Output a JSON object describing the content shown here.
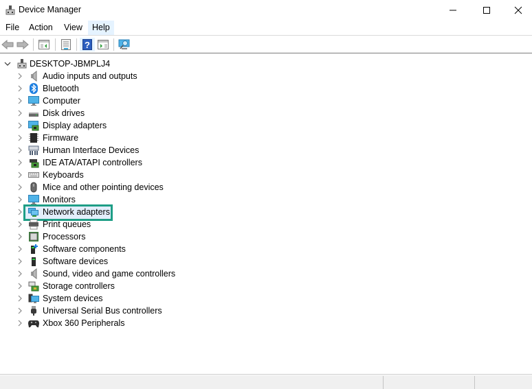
{
  "window": {
    "title": "Device Manager",
    "controls": [
      "minimize",
      "maximize",
      "close"
    ]
  },
  "menubar": {
    "items": [
      {
        "label": "File"
      },
      {
        "label": "Action"
      },
      {
        "label": "View"
      },
      {
        "label": "Help",
        "hovered": true
      }
    ]
  },
  "toolbar": {
    "buttons": [
      {
        "name": "back",
        "icon": "back-arrow-icon",
        "enabled": false
      },
      {
        "name": "forward",
        "icon": "forward-arrow-icon",
        "enabled": false
      },
      {
        "name": "show-hide-console-tree",
        "icon": "console-tree-icon"
      },
      {
        "name": "properties",
        "icon": "properties-icon"
      },
      {
        "name": "help",
        "icon": "help-icon",
        "hovered": true
      },
      {
        "name": "show-hide-action-pane",
        "icon": "action-pane-icon"
      },
      {
        "name": "scan-hardware",
        "icon": "monitor-scan-icon"
      }
    ]
  },
  "tree": {
    "root": {
      "label": "DESKTOP-JBMPLJ4",
      "expanded": true,
      "icon": "computer-tower-icon"
    },
    "children": [
      {
        "label": "Audio inputs and outputs",
        "icon": "speaker-icon"
      },
      {
        "label": "Bluetooth",
        "icon": "bluetooth-icon"
      },
      {
        "label": "Computer",
        "icon": "monitor-icon"
      },
      {
        "label": "Disk drives",
        "icon": "disk-drive-icon"
      },
      {
        "label": "Display adapters",
        "icon": "display-adapter-icon"
      },
      {
        "label": "Firmware",
        "icon": "chip-icon"
      },
      {
        "label": "Human Interface Devices",
        "icon": "hid-icon"
      },
      {
        "label": "IDE ATA/ATAPI controllers",
        "icon": "ide-controller-icon"
      },
      {
        "label": "Keyboards",
        "icon": "keyboard-icon"
      },
      {
        "label": "Mice and other pointing devices",
        "icon": "mouse-icon"
      },
      {
        "label": "Monitors",
        "icon": "monitor-icon"
      },
      {
        "label": "Network adapters",
        "icon": "network-adapter-icon",
        "selected": true
      },
      {
        "label": "Print queues",
        "icon": "printer-icon"
      },
      {
        "label": "Processors",
        "icon": "processor-icon"
      },
      {
        "label": "Software components",
        "icon": "software-component-icon"
      },
      {
        "label": "Software devices",
        "icon": "software-device-icon"
      },
      {
        "label": "Sound, video and game controllers",
        "icon": "speaker-icon"
      },
      {
        "label": "Storage controllers",
        "icon": "storage-controller-icon"
      },
      {
        "label": "System devices",
        "icon": "system-devices-icon"
      },
      {
        "label": "Universal Serial Bus controllers",
        "icon": "usb-icon"
      },
      {
        "label": "Xbox 360 Peripherals",
        "icon": "gamepad-icon"
      }
    ]
  },
  "colors": {
    "selection_border": "#1e9e86",
    "selection_background": "#e3eefb",
    "hover_background": "#e5f3ff"
  }
}
